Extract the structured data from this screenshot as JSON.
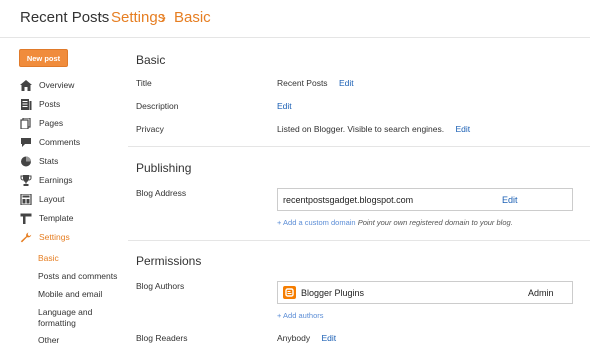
{
  "header": {
    "blog_name": "Recent Posts",
    "separator_dot": "·",
    "crumb_settings": "Settings",
    "crumb_sep": "›",
    "crumb_basic": "Basic"
  },
  "sidebar": {
    "new_post": "New post",
    "items": [
      {
        "label": "Overview",
        "icon": "home-icon"
      },
      {
        "label": "Posts",
        "icon": "posts-icon"
      },
      {
        "label": "Pages",
        "icon": "pages-icon"
      },
      {
        "label": "Comments",
        "icon": "comments-icon"
      },
      {
        "label": "Stats",
        "icon": "stats-icon"
      },
      {
        "label": "Earnings",
        "icon": "trophy-icon"
      },
      {
        "label": "Layout",
        "icon": "layout-icon"
      },
      {
        "label": "Template",
        "icon": "template-icon"
      },
      {
        "label": "Settings",
        "icon": "wrench-icon"
      }
    ],
    "sub_items": [
      {
        "label": "Basic"
      },
      {
        "label": "Posts and comments"
      },
      {
        "label": "Mobile and email"
      },
      {
        "label": "Language and formatting"
      },
      {
        "label": "Other"
      }
    ],
    "accent_color": "#e67e22"
  },
  "basic": {
    "title": "Basic",
    "title_label": "Title",
    "title_value": "Recent Posts",
    "title_edit": "Edit",
    "description_label": "Description",
    "description_edit": "Edit",
    "privacy_label": "Privacy",
    "privacy_value": "Listed on Blogger. Visible to search engines.",
    "privacy_edit": "Edit"
  },
  "publishing": {
    "title": "Publishing",
    "address_label": "Blog Address",
    "address_value": "recentpostsgadget.blogspot.com",
    "address_edit": "Edit",
    "add_domain": "+ Add a custom domain",
    "add_domain_hint": "Point your own registered domain to your blog."
  },
  "permissions": {
    "title": "Permissions",
    "authors_label": "Blog Authors",
    "author_name": "Blogger Plugins",
    "author_role": "Admin",
    "add_authors": "+ Add authors",
    "readers_label": "Blog Readers",
    "readers_value": "Anybody",
    "readers_edit": "Edit"
  },
  "colors": {
    "link": "#1a5fb4",
    "new_post_button": "#f08c3c"
  }
}
